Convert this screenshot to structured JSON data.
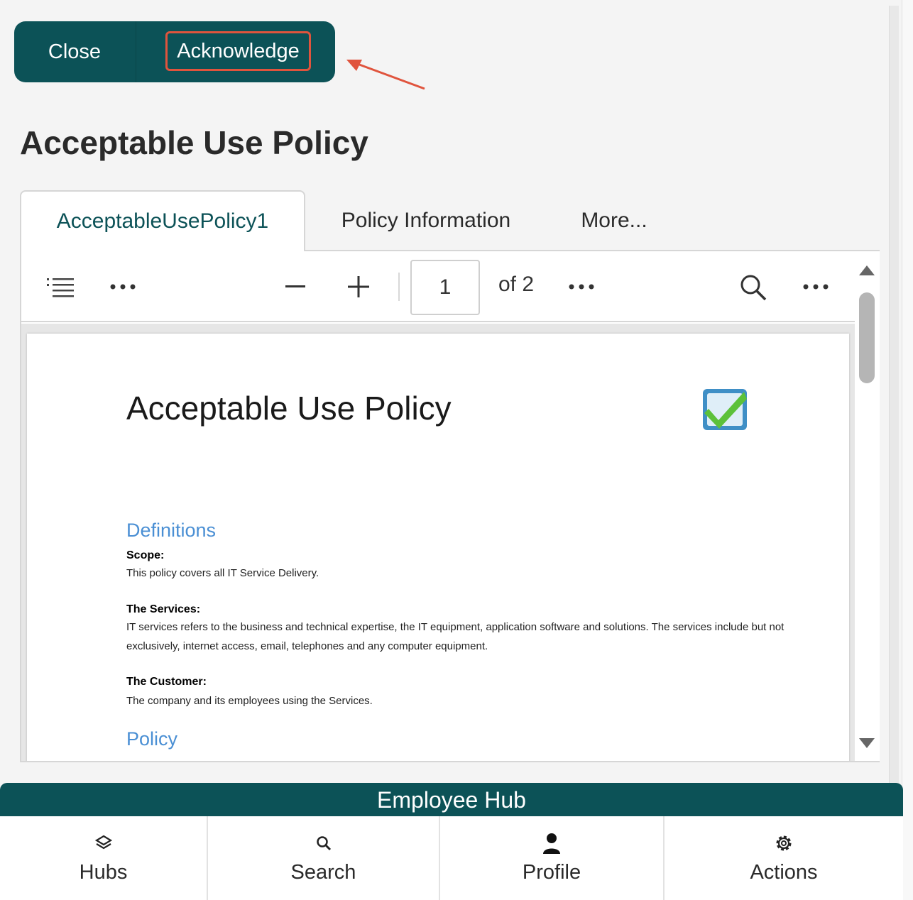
{
  "actions": {
    "close_label": "Close",
    "acknowledge_label": "Acknowledge"
  },
  "page": {
    "title": "Acceptable Use Policy"
  },
  "tabs": [
    {
      "label": "AcceptableUsePolicy1",
      "active": true
    },
    {
      "label": "Policy Information",
      "active": false
    },
    {
      "label": "More...",
      "active": false
    }
  ],
  "viewer": {
    "page_number": "1",
    "page_total_label": "of 2",
    "icons": [
      "list-icon",
      "more-icon",
      "zoom-out-icon",
      "zoom-in-icon",
      "more-icon",
      "search-icon",
      "more-icon"
    ]
  },
  "document": {
    "title": "Acceptable Use Policy",
    "definitions_heading": "Definitions",
    "scope_label": "Scope:",
    "scope_text": "This policy covers all IT Service Delivery.",
    "services_label": "The Services:",
    "services_text": "IT services refers to the business and technical expertise, the IT equipment, application software and solutions. The services include but not exclusively, internet access, email, telephones and any computer equipment.",
    "customer_label": "The Customer:",
    "customer_text": "The company and its employees using the Services.",
    "policy_heading": "Policy"
  },
  "footer": {
    "hub_title": "Employee Hub",
    "nav": [
      {
        "label": "Hubs",
        "icon": "layers-icon"
      },
      {
        "label": "Search",
        "icon": "search-icon"
      },
      {
        "label": "Profile",
        "icon": "person-icon"
      },
      {
        "label": "Actions",
        "icon": "gear-icon"
      }
    ]
  },
  "colors": {
    "brand": "#0c5257",
    "highlight": "#e0543d",
    "link_heading": "#4a8fd4"
  }
}
